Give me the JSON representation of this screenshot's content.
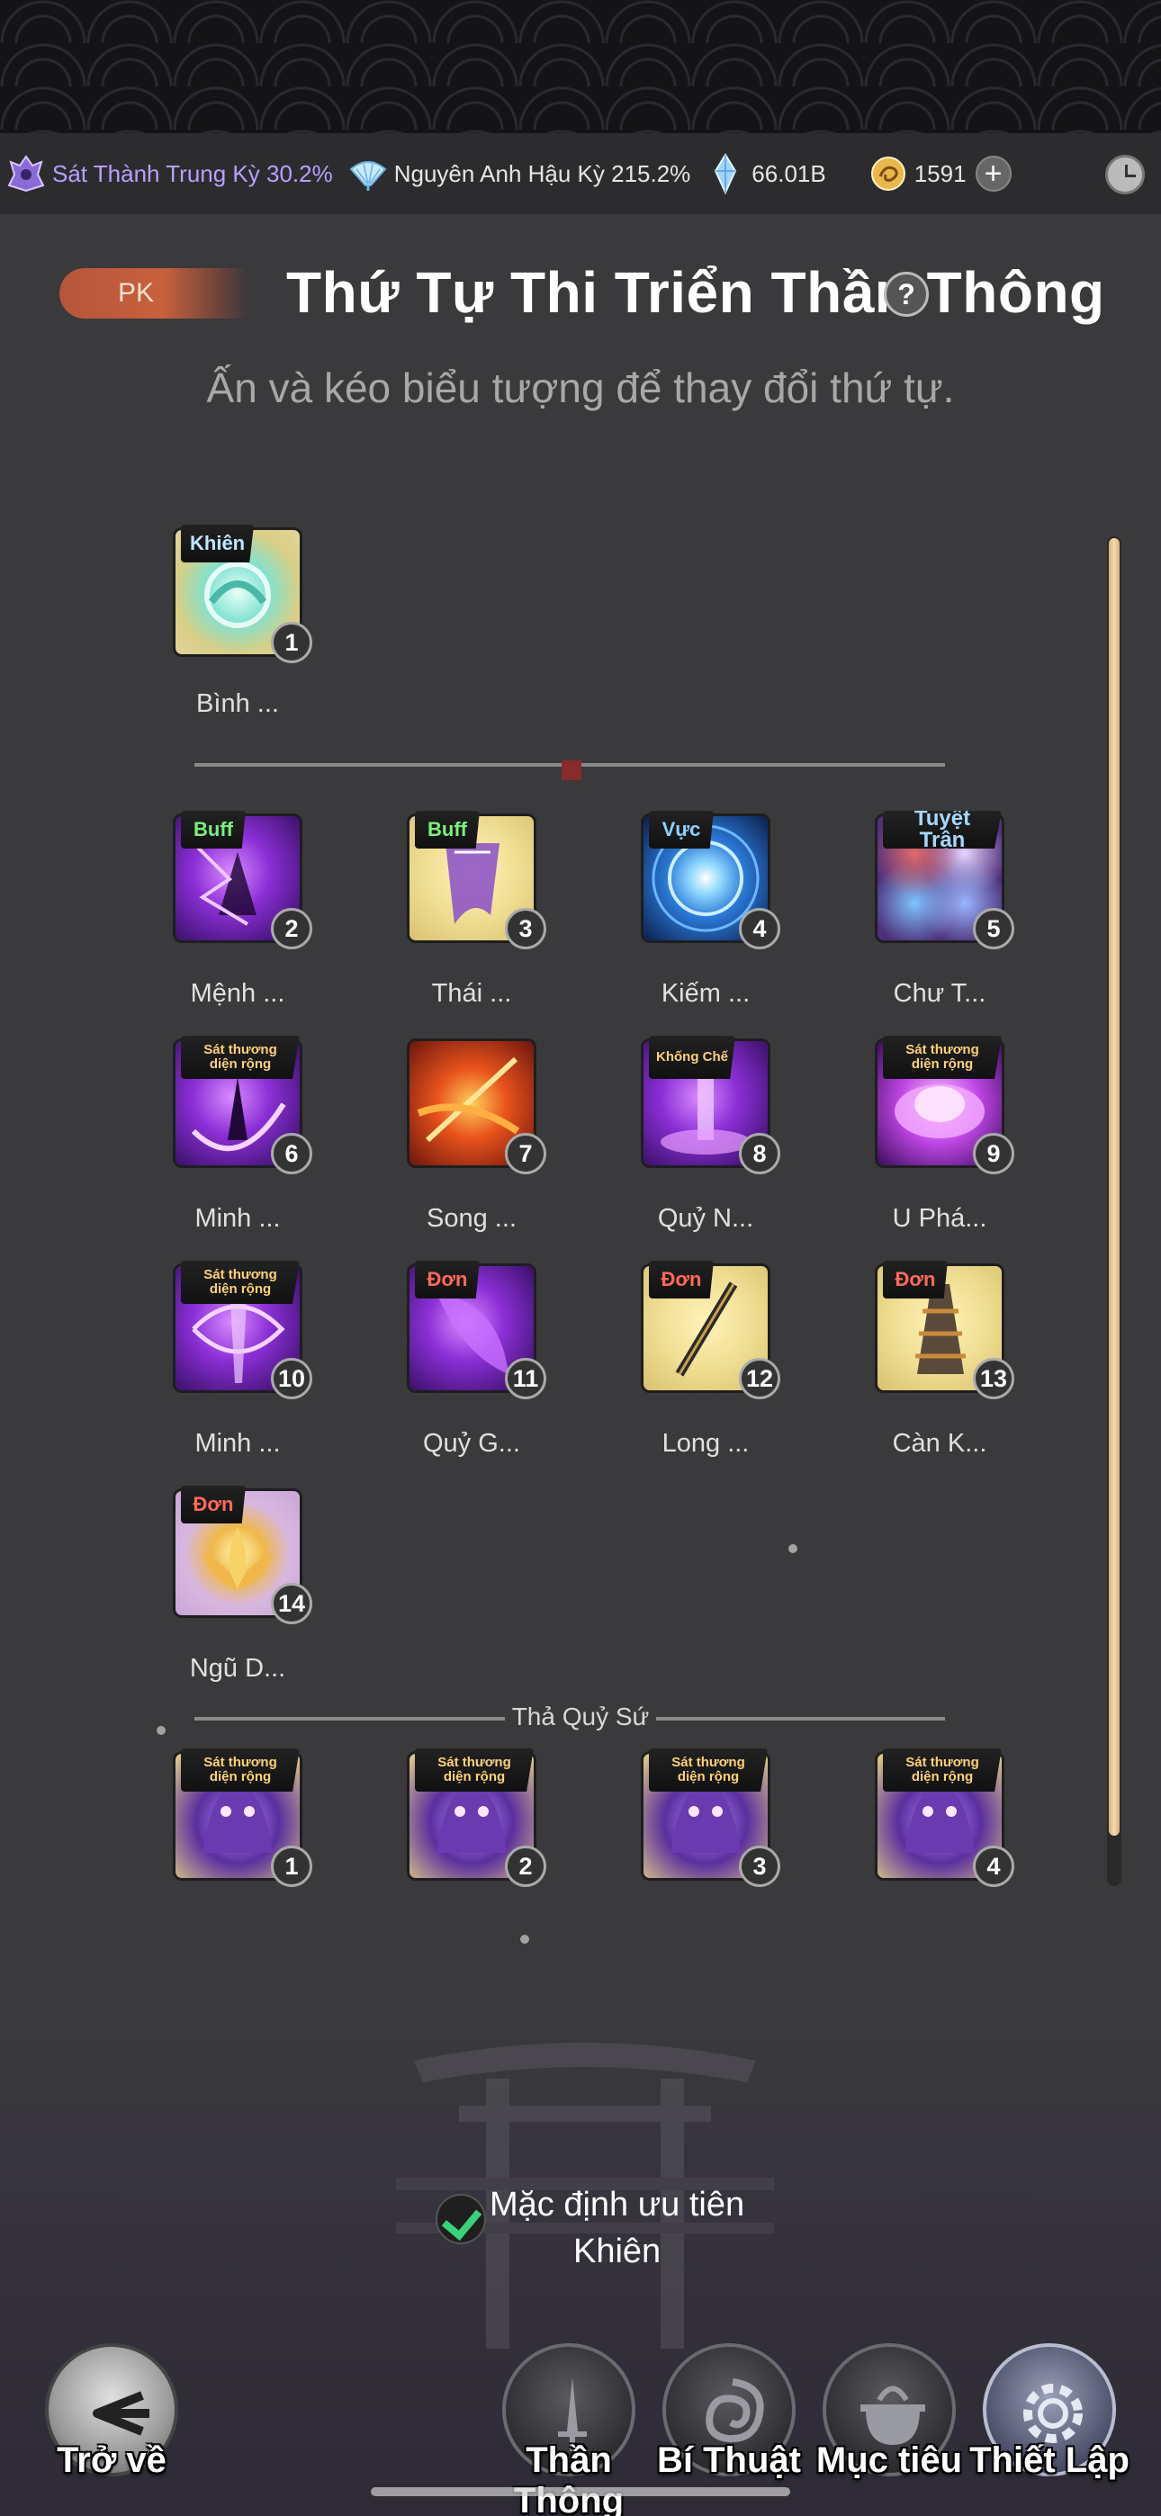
{
  "status": {
    "cultivation_1": "Sát Thành Trung Kỳ 30.2%",
    "cultivation_2": "Nguyên Anh Hậu Kỳ 215.2%",
    "spirit_stones": "66.01B",
    "currency": "1591",
    "plus": "+"
  },
  "header": {
    "pk_tag": "PK",
    "title": "Thứ Tự Thi Triển Thần Thông",
    "help": "?",
    "subtitle": "Ấn và kéo biểu tượng để thay đổi thứ tự."
  },
  "shield_skill": {
    "tag": "Khiên",
    "num": "1",
    "name": "Bình ..."
  },
  "skills": [
    {
      "tag": "Buff",
      "num": "2",
      "name": "Mệnh ..."
    },
    {
      "tag": "Buff",
      "num": "3",
      "name": "Thái ..."
    },
    {
      "tag": "Vực",
      "num": "4",
      "name": "Kiếm ..."
    },
    {
      "tag": "Tuyệt Trận",
      "num": "5",
      "name": "Chư T..."
    },
    {
      "tag": "Sát thương diện rộng",
      "num": "6",
      "name": "Minh ..."
    },
    {
      "tag": "",
      "num": "7",
      "name": "Song ..."
    },
    {
      "tag": "Khống Chế",
      "num": "8",
      "name": "Quỷ N..."
    },
    {
      "tag": "Sát thương diện rộng",
      "num": "9",
      "name": "U Phá..."
    },
    {
      "tag": "Sát thương diện rộng",
      "num": "10",
      "name": "Minh ..."
    },
    {
      "tag": "Đơn",
      "num": "11",
      "name": "Quỷ G..."
    },
    {
      "tag": "Đơn",
      "num": "12",
      "name": "Long ..."
    },
    {
      "tag": "Đơn",
      "num": "13",
      "name": "Càn K..."
    },
    {
      "tag": "Đơn",
      "num": "14",
      "name": "Ngũ D..."
    }
  ],
  "summon_section": {
    "label": "Thả Quỷ Sứ",
    "items": [
      {
        "tag": "Sát thương diện rộng",
        "num": "1"
      },
      {
        "tag": "Sát thương diện rộng",
        "num": "2"
      },
      {
        "tag": "Sát thương diện rộng",
        "num": "3"
      },
      {
        "tag": "Sát thương diện rộng",
        "num": "4"
      }
    ]
  },
  "default_priority": {
    "checked": true,
    "line1": "Mặc định ưu tiên",
    "line2": "Khiên"
  },
  "nav": {
    "back": "Trở về",
    "than_thong": "Thần Thông",
    "bi_thuat": "Bí Thuật",
    "muc_tieu": "Mục tiêu",
    "thiet_lap": "Thiết Lập"
  },
  "colors": {
    "tag_buff": "#7cf07c",
    "tag_vuc": "#8fd0ff",
    "tag_tuyet_tran": "#a8d8ff",
    "tag_aoe": "#ffd27a",
    "tag_khong_che": "#ffd27a",
    "tag_don": "#ff6a5a",
    "tag_khien": "#bfe6ff",
    "check": "#3bd07a",
    "scroll_thumb": "#f3dcae"
  }
}
